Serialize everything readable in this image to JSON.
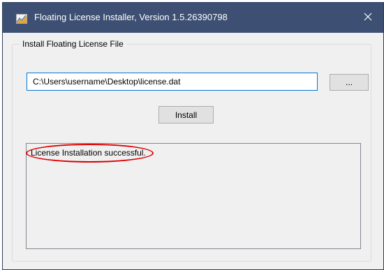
{
  "window": {
    "title": "Floating License Installer, Version 1.5.26390798",
    "app_icon": "chart-document-icon",
    "close_icon": "close-icon",
    "titlebar_color": "#3d4f73"
  },
  "group": {
    "label": "Install Floating License File"
  },
  "file_path": {
    "value": "C:\\Users\\username\\Desktop\\license.dat"
  },
  "buttons": {
    "browse_label": "...",
    "install_label": "Install"
  },
  "output": {
    "status_text": "License Installation successful.",
    "highlight_color": "#e00000"
  }
}
